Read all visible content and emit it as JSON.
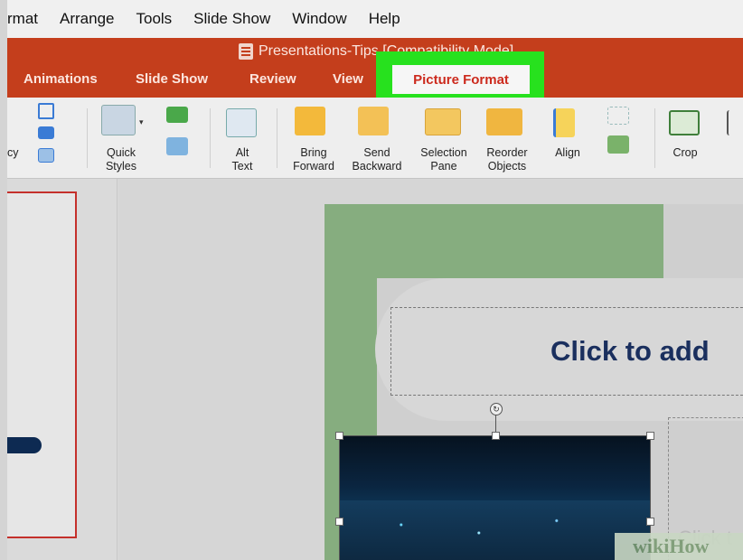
{
  "menubar": [
    "rmat",
    "Arrange",
    "Tools",
    "Slide Show",
    "Window",
    "Help"
  ],
  "window_title": "Presentations-Tips [Compatibility Mode]",
  "tabs": [
    {
      "label": "Animations"
    },
    {
      "label": "Slide Show"
    },
    {
      "label": "Review"
    },
    {
      "label": "View"
    }
  ],
  "active_tab": "Picture Format",
  "ribbon": {
    "transparency": "cy",
    "quick_styles": "Quick\nStyles",
    "alt_text": "Alt\nText",
    "bring_forward": "Bring\nForward",
    "send_backward": "Send\nBackward",
    "selection_pane": "Selection\nPane",
    "reorder_objects": "Reorder\nObjects",
    "align": "Align",
    "crop": "Crop"
  },
  "slide": {
    "title_placeholder": "Click to add",
    "body_placeholder": "Click t"
  },
  "watermark": "wikiHow",
  "colors": {
    "accent_red": "#c43e1c",
    "highlight_green": "#27e11e",
    "slide_green": "#86ad7f"
  }
}
